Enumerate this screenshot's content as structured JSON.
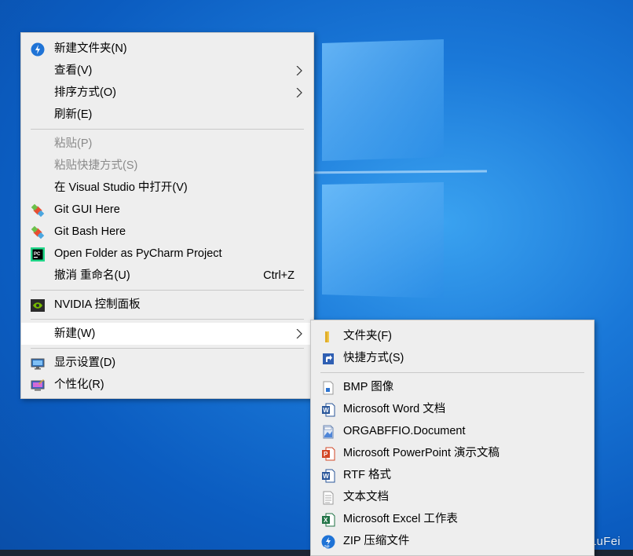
{
  "main_menu": {
    "items": [
      {
        "label": "新建文件夹(N)",
        "icon": "new-folder-icon"
      },
      {
        "label": "查看(V)",
        "submenu": true
      },
      {
        "label": "排序方式(O)",
        "submenu": true
      },
      {
        "label": "刷新(E)"
      },
      {
        "label": "粘贴(P)",
        "disabled": true
      },
      {
        "label": "粘贴快捷方式(S)",
        "disabled": true
      },
      {
        "label": "在 Visual Studio 中打开(V)"
      },
      {
        "label": "Git GUI Here",
        "icon": "git-icon"
      },
      {
        "label": "Git Bash Here",
        "icon": "git-icon"
      },
      {
        "label": "Open Folder as PyCharm Project",
        "icon": "pycharm-icon"
      },
      {
        "label": "撤消 重命名(U)",
        "shortcut": "Ctrl+Z"
      },
      {
        "label": "NVIDIA 控制面板",
        "icon": "nvidia-icon"
      },
      {
        "label": "新建(W)",
        "submenu": true,
        "highlight": true
      },
      {
        "label": "显示设置(D)",
        "icon": "display-icon"
      },
      {
        "label": "个性化(R)",
        "icon": "personalize-icon"
      }
    ]
  },
  "sub_menu": {
    "items": [
      {
        "label": "文件夹(F)",
        "icon": "folder-icon"
      },
      {
        "label": "快捷方式(S)",
        "icon": "shortcut-icon"
      },
      {
        "label": "BMP 图像",
        "icon": "bmp-icon"
      },
      {
        "label": "Microsoft Word 文档",
        "icon": "word-icon"
      },
      {
        "label": "ORGABFFIO.Document",
        "icon": "document-icon"
      },
      {
        "label": "Microsoft PowerPoint 演示文稿",
        "icon": "powerpoint-icon"
      },
      {
        "label": "RTF 格式",
        "icon": "rtf-icon"
      },
      {
        "label": "文本文档",
        "icon": "text-document-icon"
      },
      {
        "label": "Microsoft Excel 工作表",
        "icon": "excel-icon"
      },
      {
        "label": "ZIP 压缩文件",
        "icon": "zip-icon"
      }
    ]
  },
  "watermark": "CSDN @CDL_LuFei",
  "colors": {
    "menu_bg": "#eeeeee",
    "highlight": "#ffffff",
    "desktop": "#1a78d8"
  }
}
